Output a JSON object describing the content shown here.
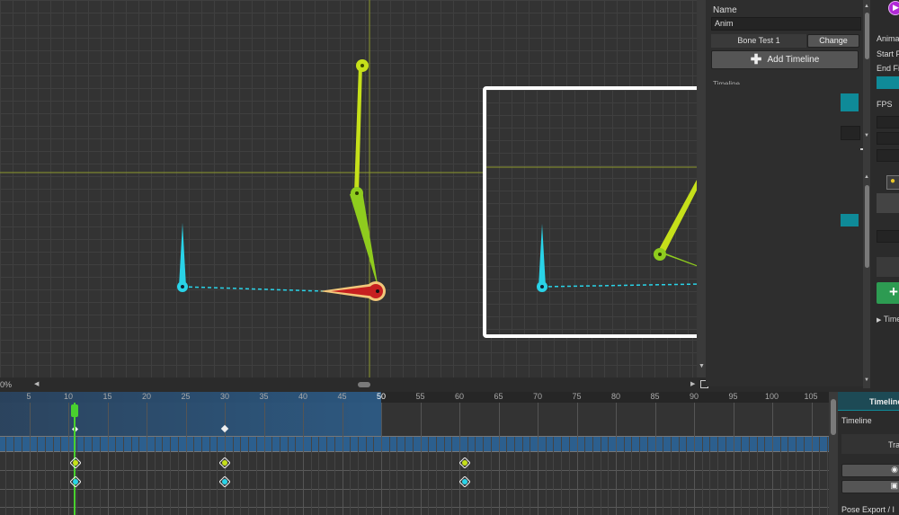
{
  "viewport": {
    "zoom_label": "0%"
  },
  "inspector": {
    "name_label": "Name",
    "name_value": "Anim",
    "bone_label": "Bone Test 1",
    "change_button": "Change",
    "add_timeline_button": "Add Timeline",
    "timeline_cut_label": "Timeline"
  },
  "right_panel": {
    "labels": [
      "Anima",
      "Start F",
      "End Fi",
      "FPS"
    ],
    "timeline_toggle": "Time"
  },
  "ruler": {
    "ticks": [
      "5",
      "10",
      "15",
      "20",
      "25",
      "30",
      "35",
      "40",
      "45",
      "50",
      "55",
      "60",
      "65",
      "70",
      "75",
      "80",
      "85",
      "90",
      "95",
      "100",
      "105"
    ],
    "playhead_frame": 11
  },
  "timeline_panel": {
    "header": "Timeline",
    "timeline_label": "Timeline",
    "track_label": "Tra",
    "pose_export": "Pose Export / I"
  },
  "colors": {
    "bone_cyan": "#29d3e8",
    "bone_lime": "#c6e01a",
    "bone_green": "#8fcc1e",
    "selected_bone_red": "#c62020",
    "accent_teal": "#0f8a98",
    "playhead": "#49d12e",
    "range_blue": "#2c5f8e"
  }
}
